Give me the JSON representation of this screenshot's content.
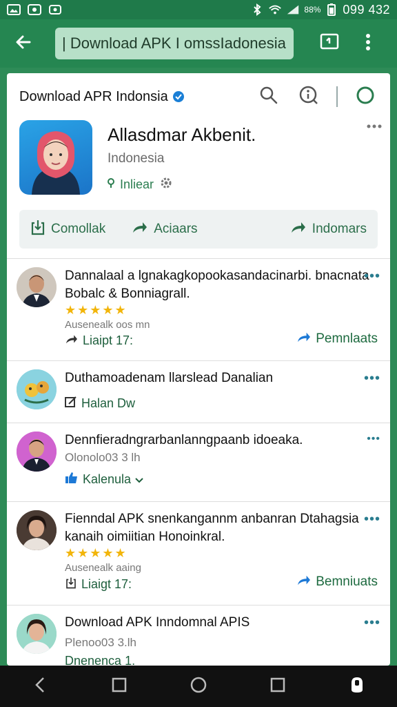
{
  "status_bar": {
    "left_icons": [
      "image-icon",
      "photo-icon",
      "camera-icon"
    ],
    "right_icons": [
      "bluetooth-icon",
      "wifi-icon",
      "signal-icon",
      "battery-icon"
    ],
    "signal_label": "88%",
    "time": "099 432"
  },
  "app_bar": {
    "url": "| Download APK I omssIadonesia"
  },
  "page": {
    "title": "Download APR Indonsia",
    "app_name": "Allasdmar Akbenit.",
    "app_subtitle": "Indonesia",
    "app_status": "Inliear",
    "actions": [
      "Comollak",
      "Aciaars",
      "Indomars"
    ]
  },
  "feed": [
    {
      "text": "Dannalaal a lgnakagkopookasandacinarbi. bnacnata Bobalc & Bonniagrall.",
      "stars": "★★★★★",
      "meta": "Ausenealk oos mn",
      "action": "Liaipt 17:",
      "link": "Pemnlaats"
    },
    {
      "text": "Duthamoadenam llarslead Danalian",
      "action": "Halan Dw"
    },
    {
      "text": "Dennfieradngrarbanlanngpaanb idoeaka.",
      "meta": "Olonolo03 3 lh",
      "action": "Kalenula"
    },
    {
      "text": "Fienndal APK snenkangannm anbanran Dtahagsia kanaih oimiitian Honoinkral.",
      "stars": "★★★★★",
      "meta": "Ausenealk aaing",
      "action": "Liaigt 17:",
      "link": "Bemniuats"
    },
    {
      "text": "Download APK Inndomnal APIS",
      "meta": "Plenoo03 3.lh",
      "action": "Dnenenca 1."
    }
  ],
  "colors": {
    "appbar": "#258651",
    "accent": "#2a7d4f",
    "star": "#f2b50a"
  }
}
